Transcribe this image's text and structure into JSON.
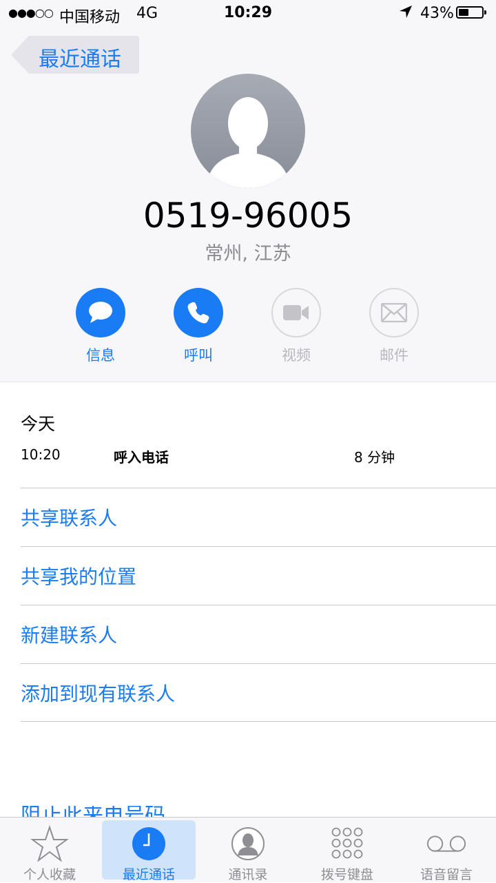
{
  "status_bar": {
    "signal": "●●●○○",
    "carrier": "中国移动",
    "network": "4G",
    "time": "10:29",
    "battery_percent": "43%",
    "battery_level": 0.43
  },
  "nav": {
    "back_label": "最近通话"
  },
  "contact": {
    "phone_number": "0519-96005",
    "location": "常州, 江苏"
  },
  "actions": [
    {
      "label": "信息",
      "icon": "message-icon",
      "enabled": true
    },
    {
      "label": "呼叫",
      "icon": "phone-icon",
      "enabled": true
    },
    {
      "label": "视频",
      "icon": "video-icon",
      "enabled": false
    },
    {
      "label": "邮件",
      "icon": "mail-icon",
      "enabled": false
    }
  ],
  "recent": {
    "day": "今天",
    "calls": [
      {
        "time": "10:20",
        "type": "呼入电话",
        "duration": "8 分钟"
      }
    ]
  },
  "options": [
    {
      "label": "共享联系人"
    },
    {
      "label": "共享我的位置"
    },
    {
      "label": "新建联系人"
    },
    {
      "label": "添加到现有联系人"
    }
  ],
  "partial_option": "阻止此来电号码",
  "tabs": [
    {
      "label": "个人收藏",
      "icon": "star-icon",
      "selected": false
    },
    {
      "label": "最近通话",
      "icon": "clock-icon",
      "selected": true
    },
    {
      "label": "通讯录",
      "icon": "contacts-icon",
      "selected": false
    },
    {
      "label": "拨号键盘",
      "icon": "keypad-icon",
      "selected": false
    },
    {
      "label": "语音留言",
      "icon": "voicemail-icon",
      "selected": false
    }
  ],
  "colors": {
    "accent": "#1a7cf5",
    "inactive": "#b7b7bc",
    "secondary_text": "#8a8a8f"
  }
}
